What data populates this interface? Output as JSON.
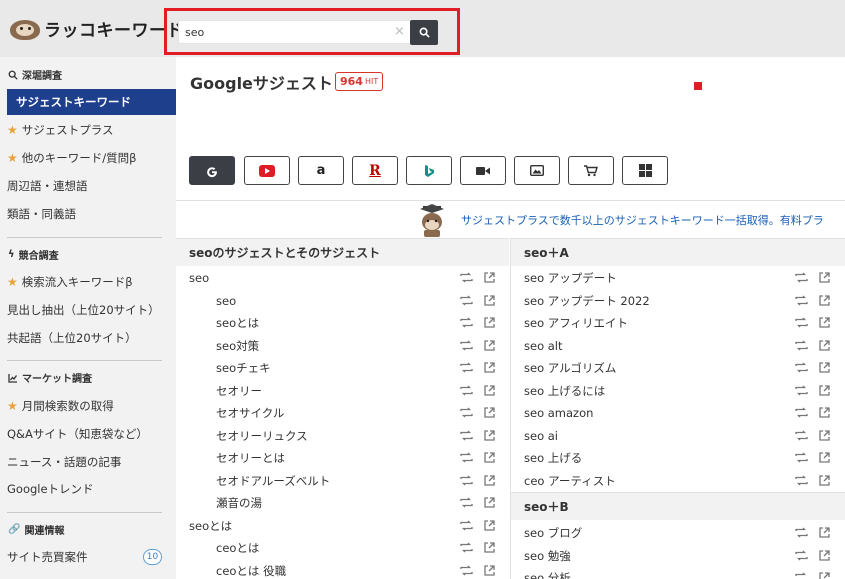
{
  "app": {
    "logo_text": "ラッコキーワード"
  },
  "search": {
    "value": "seo",
    "clear": "×"
  },
  "sidebar": {
    "sections": [
      {
        "title": "深堀調査"
      },
      {
        "title": "競合調査"
      },
      {
        "title": "マーケット調査"
      },
      {
        "title": "関連情報"
      }
    ],
    "items": [
      {
        "label": "サジェストキーワード"
      },
      {
        "label": "サジェストプラス"
      },
      {
        "label": "他のキーワード/質問β"
      },
      {
        "label": "周辺語・連想語"
      },
      {
        "label": "類語・同義語"
      },
      {
        "label": "検索流入キーワードβ"
      },
      {
        "label": "見出し抽出（上位20サイト）"
      },
      {
        "label": "共起語（上位20サイト）"
      },
      {
        "label": "月間検索数の取得"
      },
      {
        "label": "Q&Aサイト（知恵袋など）"
      },
      {
        "label": "ニュース・話題の記事"
      },
      {
        "label": "Googleトレンド"
      },
      {
        "label": "サイト売買案件"
      }
    ],
    "badge": "10"
  },
  "main": {
    "title": "Googleサジェスト",
    "hit_count": "964",
    "hit_label": "HIT",
    "engines": [
      "google-icon",
      "youtube-icon",
      "amazon-icon",
      "rakuten-icon",
      "bing-icon",
      "video-icon",
      "image-icon",
      "shopping-icon",
      "windows-icon"
    ],
    "banner": "サジェストプラスで数千以上のサジェストキーワード一括取得。有料プラ"
  },
  "left_panel": {
    "header": "seoのサジェストとそのサジェスト",
    "rows": [
      {
        "text": "seo",
        "indent": false
      },
      {
        "text": "seo",
        "indent": true
      },
      {
        "text": "seoとは",
        "indent": true
      },
      {
        "text": "seo対策",
        "indent": true
      },
      {
        "text": "seoチェキ",
        "indent": true
      },
      {
        "text": "セオリー",
        "indent": true
      },
      {
        "text": "セオサイクル",
        "indent": true
      },
      {
        "text": "セオリーリュクス",
        "indent": true
      },
      {
        "text": "セオリーとは",
        "indent": true
      },
      {
        "text": "セオドアルーズベルト",
        "indent": true
      },
      {
        "text": "瀬音の湯",
        "indent": true
      },
      {
        "text": "seoとは",
        "indent": false
      },
      {
        "text": "ceoとは",
        "indent": true
      },
      {
        "text": "ceoとは 役職",
        "indent": true
      }
    ]
  },
  "right_panel": {
    "header_a": "seo＋A",
    "rows_a": [
      "seo アップデート",
      "seo アップデート 2022",
      "seo アフィリエイト",
      "seo alt",
      "seo アルゴリズム",
      "seo 上げるには",
      "seo amazon",
      "seo ai",
      "seo 上げる",
      "ceo アーティスト"
    ],
    "header_b": "seo＋B",
    "rows_b": [
      "seo ブログ",
      "seo 勉強",
      "seo 分析"
    ]
  }
}
